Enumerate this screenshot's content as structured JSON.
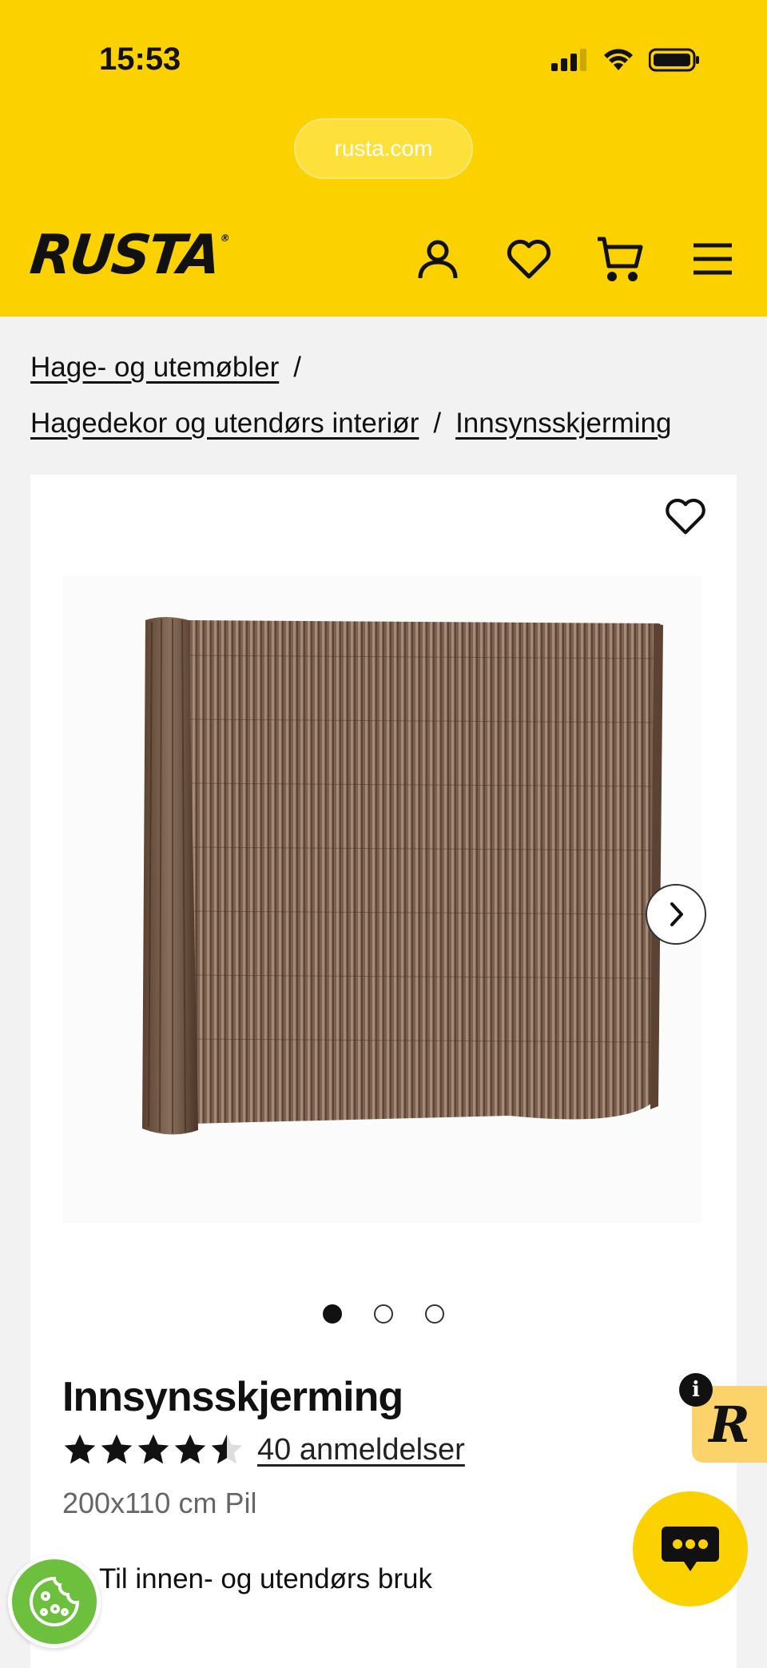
{
  "status_bar": {
    "time": "15:53"
  },
  "browser": {
    "url": "rusta.com"
  },
  "header": {
    "logo": "RUSTA",
    "icons": [
      "account-icon",
      "heart-icon",
      "cart-icon",
      "menu-icon"
    ]
  },
  "breadcrumb": {
    "items": [
      "Hage- og utemøbler",
      "Hagedekor og utendørs interiør",
      "Innsynsskjerming"
    ],
    "separator": "/"
  },
  "product": {
    "title": "Innsynsskjerming",
    "rating": 4.5,
    "rating_max": 5,
    "reviews": "40 anmeldelser",
    "variant": "200x110 cm Pil",
    "feature": "Til innen- og utendørs bruk",
    "gallery": {
      "images": 3,
      "active": 1
    }
  },
  "colors": {
    "brand_yellow": "#fcd100",
    "background": "#f2f2f2",
    "cookie_green": "#6dbf3e"
  }
}
